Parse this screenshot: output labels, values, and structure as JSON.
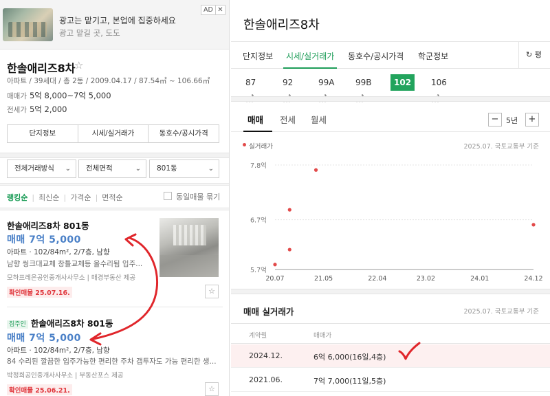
{
  "ad": {
    "title": "광고는 맡기고, 본업에 집중하세요",
    "subtitle": "광고 맡길 곳, 도도",
    "badge": "AD",
    "close": "✕"
  },
  "complex": {
    "name": "한솔애리즈8차",
    "star": "☆",
    "meta": "아파트 / 39세대 / 총 2동 / 2009.04.17 / 87.54㎡ ~ 106.66㎡",
    "sale_label": "매매가",
    "sale_value": "5억 8,000~7억 5,000",
    "jeonse_label": "전세가",
    "jeonse_value": "5억 2,000"
  },
  "left_tabs": [
    "단지정보",
    "시세/실거래가",
    "동호수/공시가격"
  ],
  "filters": {
    "trade_type": "전체거래방식",
    "area": "전체면적",
    "building": "801동",
    "chev": "⌄"
  },
  "sort": {
    "items": [
      "랭킹순",
      "최신순",
      "가격순",
      "면적순"
    ],
    "separator": "|",
    "group_same": "동일매물 묶기"
  },
  "listings": [
    {
      "title": "한솔애리즈8차 801동",
      "tag": "",
      "price": "매매 7억 5,000",
      "spec": "아파트 · 102/84m², 2/7층, 남향",
      "desc": "남향 씽크대교체 창틀교체등 올수리됨 입주...",
      "agent": "모하프레온공인중개사사무소 | 매경부동산 제공",
      "confirm": "확인매물 25.07.16.",
      "fav": "☆"
    },
    {
      "title": "한솔애리즈8차 801동",
      "tag": "집주인",
      "price": "매매 7억 5,000",
      "spec": "아파트 · 102/84m², 2/7층, 남향",
      "desc": "84 수리된 깔끔한 입주가능한 편리한 주차 갭투자도 가능 편리한 생...",
      "agent": "박정희공인중개사사무소 | 부동산포스 제공",
      "confirm": "확인매물 25.06.21.",
      "fav": "☆"
    }
  ],
  "right": {
    "title": "한솔애리즈8차",
    "tabs": [
      "단지정보",
      "시세/실거래가",
      "동호수/공시가격",
      "학군정보"
    ],
    "refresh": "↻ 평",
    "sizes": [
      "87㎡",
      "92㎡",
      "99A㎡",
      "99B㎡",
      "102㎡",
      "106㎡"
    ],
    "trade_tabs": [
      "매매",
      "전세",
      "월세"
    ],
    "minus": "−",
    "plus": "+",
    "period": "5년",
    "legend": "실거래가",
    "source": "2025.07. 국토교통부 기준",
    "tx_title": "매매 실거래가",
    "tx_source": "2025.07. 국토교통부 기준",
    "tx_head_date": "계약월",
    "tx_head_price": "매매가",
    "tx_rows": [
      {
        "date": "2024.12.",
        "price": "6억 6,000(16일,4층)"
      },
      {
        "date": "2021.06.",
        "price": "7억 7,000(11일,5층)"
      }
    ]
  },
  "colors": {
    "accent": "#1d9d58",
    "price_blue": "#4a80c7",
    "point_red": "#e24a4a",
    "annotation_red": "#e0262b"
  },
  "chart_data": {
    "type": "scatter",
    "title": "",
    "xlabel": "",
    "ylabel": "",
    "y_tick_labels": [
      "7.8억",
      "6.7억",
      "5.7억"
    ],
    "y_ticks": [
      7.8,
      6.7,
      5.7
    ],
    "ylim": [
      5.7,
      7.8
    ],
    "x_tick_labels": [
      "20.07",
      "21.05",
      "22.04",
      "23.02",
      "24.01",
      "24.12"
    ],
    "x_ticks": [
      2020.5,
      2021.33,
      2022.25,
      2023.08,
      2024.0,
      2024.92
    ],
    "xlim": [
      2020.5,
      2024.92
    ],
    "grid": "horizontal",
    "series": [
      {
        "name": "실거래가",
        "points": [
          {
            "x": 2020.5,
            "y": 5.8
          },
          {
            "x": 2020.75,
            "y": 6.1
          },
          {
            "x": 2020.75,
            "y": 6.9
          },
          {
            "x": 2021.2,
            "y": 7.7
          },
          {
            "x": 2024.92,
            "y": 6.6
          }
        ]
      }
    ]
  }
}
